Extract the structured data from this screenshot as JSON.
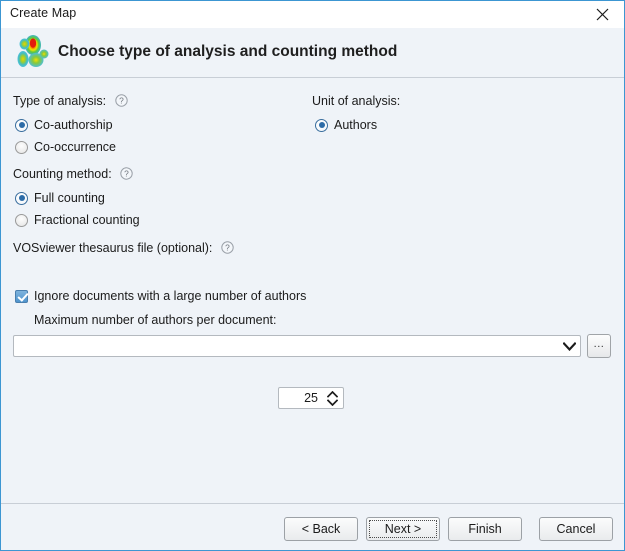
{
  "window": {
    "title": "Create Map",
    "close_icon": "close-icon",
    "border_color": "#3c96d2",
    "background": "#eff3f8"
  },
  "header": {
    "icon": "vosviewer-density-map-icon",
    "title": "Choose type of analysis and counting method"
  },
  "type_of_analysis": {
    "label": "Type of analysis:",
    "help_icon": "help-icon",
    "options": [
      {
        "label": "Co-authorship",
        "selected": true
      },
      {
        "label": "Co-occurrence",
        "selected": false
      }
    ]
  },
  "unit_of_analysis": {
    "label": "Unit of analysis:",
    "options": [
      {
        "label": "Authors",
        "selected": true
      }
    ]
  },
  "counting_method": {
    "label": "Counting method:",
    "help_icon": "help-icon",
    "options": [
      {
        "label": "Full counting",
        "selected": true
      },
      {
        "label": "Fractional counting",
        "selected": false
      }
    ]
  },
  "thesaurus": {
    "label": "VOSviewer thesaurus file (optional):",
    "help_icon": "help-icon",
    "value": "",
    "placeholder": "",
    "dropdown_icon": "chevron-down-icon",
    "browse_label": "...",
    "browse_icon": "ellipsis-icon"
  },
  "ignore_documents": {
    "label": "Ignore documents with a large number of authors",
    "checked": true,
    "max_authors": {
      "label": "Maximum number of authors per document:",
      "value": "25",
      "up_icon": "chevron-up-icon",
      "down_icon": "chevron-down-icon"
    }
  },
  "footer": {
    "buttons": [
      {
        "label": "< Back",
        "focused": false
      },
      {
        "label": "Next >",
        "focused": true
      },
      {
        "label": "Finish",
        "focused": false
      },
      {
        "label": "Cancel",
        "focused": false
      }
    ]
  }
}
